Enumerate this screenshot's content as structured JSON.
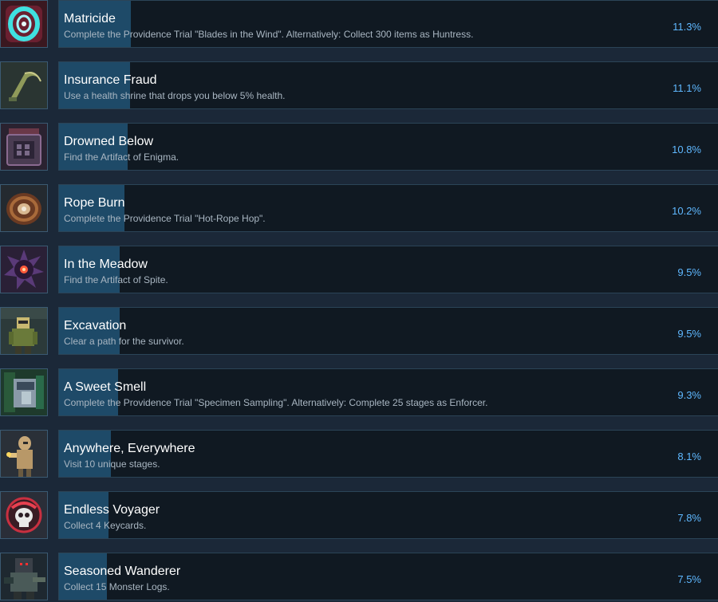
{
  "achievements": [
    {
      "title": "Matricide",
      "description": "Complete the Providence Trial \"Blades in the Wind\". Alternatively: Collect 300 items as Huntress.",
      "percent": "11.3%",
      "unlock_fraction": 0.113,
      "icon": "swirl-portal-icon"
    },
    {
      "title": "Insurance Fraud",
      "description": "Use a health shrine that drops you below 5% health.",
      "percent": "11.1%",
      "unlock_fraction": 0.111,
      "icon": "sickle-icon"
    },
    {
      "title": "Drowned Below",
      "description": "Find the Artifact of Enigma.",
      "percent": "10.8%",
      "unlock_fraction": 0.108,
      "icon": "artifact-cube-icon"
    },
    {
      "title": "Rope Burn",
      "description": "Complete the Providence Trial \"Hot-Rope Hop\".",
      "percent": "10.2%",
      "unlock_fraction": 0.102,
      "icon": "rope-coil-icon"
    },
    {
      "title": "In the Meadow",
      "description": "Find the Artifact of Spite.",
      "percent": "9.5%",
      "unlock_fraction": 0.095,
      "icon": "spiked-orb-icon"
    },
    {
      "title": "Excavation",
      "description": "Clear a path for the survivor.",
      "percent": "9.5%",
      "unlock_fraction": 0.095,
      "icon": "miner-character-icon"
    },
    {
      "title": "A Sweet Smell",
      "description": "Complete the Providence Trial \"Specimen Sampling\". Alternatively: Complete 25 stages as Enforcer.",
      "percent": "9.3%",
      "unlock_fraction": 0.093,
      "icon": "enforcer-shield-icon"
    },
    {
      "title": "Anywhere, Everywhere",
      "description": "Visit 10 unique stages.",
      "percent": "8.1%",
      "unlock_fraction": 0.081,
      "icon": "robot-character-icon"
    },
    {
      "title": "Endless Voyager",
      "description": "Collect 4 Keycards.",
      "percent": "7.8%",
      "unlock_fraction": 0.078,
      "icon": "skull-emblem-icon"
    },
    {
      "title": "Seasoned Wanderer",
      "description": "Collect 15 Monster Logs.",
      "percent": "7.5%",
      "unlock_fraction": 0.075,
      "icon": "soldier-character-icon"
    }
  ]
}
